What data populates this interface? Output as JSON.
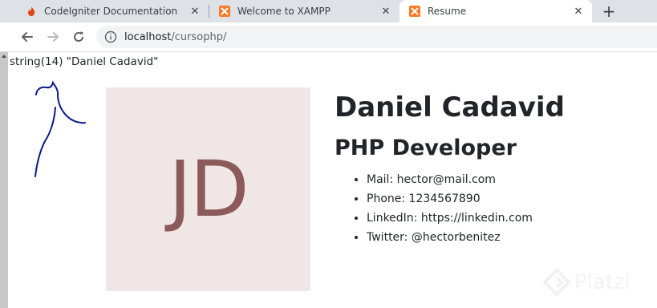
{
  "browser": {
    "tabs": [
      {
        "title": "CodeIgniter Documentation",
        "icon": "codeigniter-flame-icon",
        "active": false
      },
      {
        "title": "Welcome to XAMPP",
        "icon": "xampp-icon",
        "active": false
      },
      {
        "title": "Resume",
        "icon": "xampp-icon",
        "active": true
      }
    ],
    "close_glyph": "✕",
    "new_tab_glyph": "+",
    "url_host": "localhost",
    "url_path": "/cursophp/"
  },
  "page": {
    "debug_output": "string(14) \"Daniel Cadavid\"",
    "photo_initials": "JD",
    "name": "Daniel Cadavid",
    "title": "PHP Developer",
    "contacts": [
      "Mail: hector@mail.com",
      "Phone: 1234567890",
      "LinkedIn: https://linkedin.com",
      "Twitter: @hectorbenitez"
    ]
  },
  "watermark": {
    "text": "Platzi",
    "icon": "platzi-logo-icon"
  },
  "colors": {
    "tabstrip": "#dee1e6",
    "photo_bg": "#f0e6e6",
    "initials": "#8c5a58",
    "text": "#212529",
    "doodle": "#0a1a8c",
    "xampp": "#fb7a24"
  }
}
